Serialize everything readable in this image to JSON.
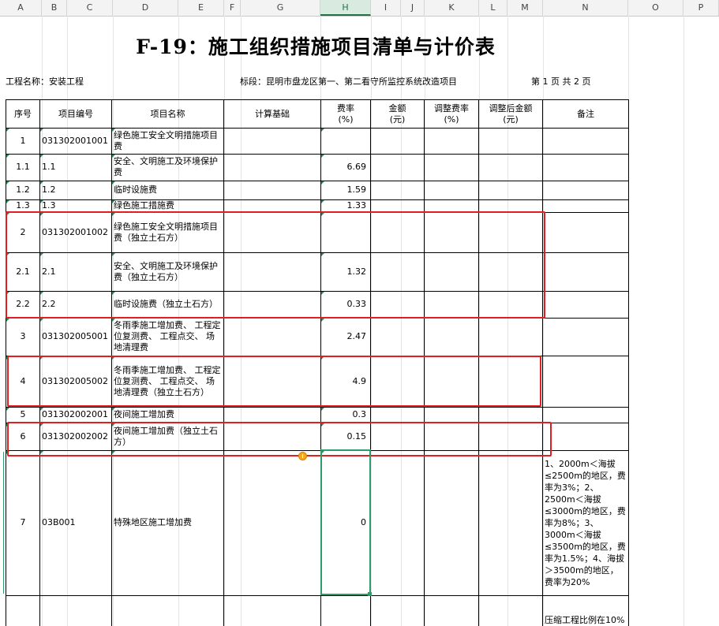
{
  "columns": [
    "A",
    "B",
    "C",
    "D",
    "E",
    "F",
    "G",
    "H",
    "I",
    "J",
    "K",
    "L",
    "M",
    "N",
    "O",
    "P"
  ],
  "title": "F-19：施工组织措施项目清单与计价表",
  "project_name": "工程名称：安装工程",
  "section": "标段：昆明市盘龙区第一、第二看守所监控系统改造项目",
  "page_info": "第  1  页  共  2  页",
  "headers": {
    "no": "序号",
    "code": "项目编号",
    "name": "项目名称",
    "basis": "计算基础",
    "rate": "费率\n(%)",
    "amount": "金额\n(元)",
    "adj_rate": "调整费率\n(%)",
    "adj_amount": "调整后金额\n(元)",
    "remark": "备注"
  },
  "rows": [
    {
      "no": "1",
      "code": "031302001001",
      "name": "绿色施工安全文明措施项目费",
      "rate": "",
      "remark": ""
    },
    {
      "no": "1.1",
      "code": "1.1",
      "name": "安全、文明施工及环境保护费",
      "rate": "6.69",
      "remark": ""
    },
    {
      "no": "1.2",
      "code": "1.2",
      "name": "临时设施费",
      "rate": "1.59",
      "remark": ""
    },
    {
      "no": "1.3",
      "code": "1.3",
      "name": "绿色施工措施费",
      "rate": "1.33",
      "remark": ""
    },
    {
      "no": "2",
      "code": "031302001002",
      "name": "绿色施工安全文明措施项目费（独立土石方）",
      "rate": "",
      "remark": ""
    },
    {
      "no": "2.1",
      "code": "2.1",
      "name": "安全、文明施工及环境保护费（独立土石方）",
      "rate": "1.32",
      "remark": ""
    },
    {
      "no": "2.2",
      "code": "2.2",
      "name": "临时设施费（独立土石方）",
      "rate": "0.33",
      "remark": ""
    },
    {
      "no": "3",
      "code": "031302005001",
      "name": "冬雨季施工增加费、 工程定位复测费、 工程点交、 场地清理费",
      "rate": "2.47",
      "remark": ""
    },
    {
      "no": "4",
      "code": "031302005002",
      "name": "冬雨季施工增加费、 工程定位复测费、 工程点交、 场地清理费（独立土石方）",
      "rate": "4.9",
      "remark": ""
    },
    {
      "no": "5",
      "code": "031302002001",
      "name": "夜间施工增加费",
      "rate": "0.3",
      "remark": ""
    },
    {
      "no": "6",
      "code": "031302002002",
      "name": "夜间施工增加费（独立土石方）",
      "rate": "0.15",
      "remark": ""
    },
    {
      "no": "7",
      "code": "03B001",
      "name": "特殊地区施工增加费",
      "rate": "0",
      "remark": "1、2000m＜海拔≤2500m的地区，费率为3%；2、2500m＜海拔≤3000m的地区，费率为8%；3、3000m＜海拔≤3500m的地区，费率为1.5%；4、海拔＞3500m的地区，费率为20%"
    },
    {
      "no": "",
      "code": "",
      "name": "",
      "rate": "",
      "remark": "压缩工程比例在10%"
    }
  ],
  "colors": {
    "highlight": "#e02020",
    "selection": "#2e9b6a"
  }
}
